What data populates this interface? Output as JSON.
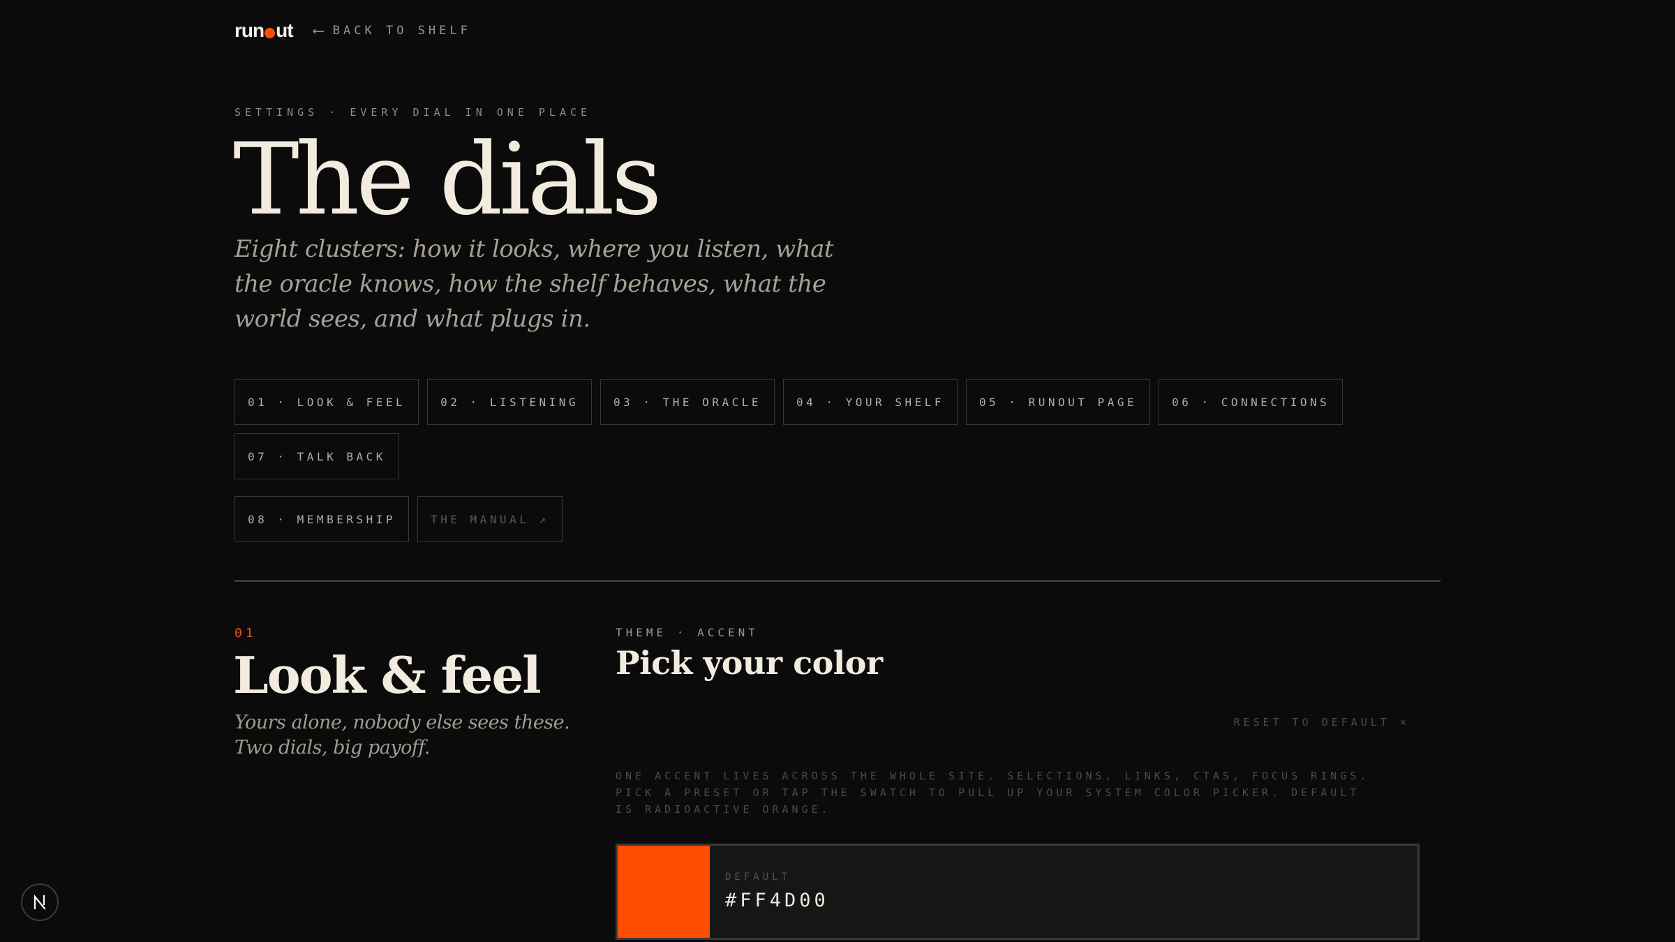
{
  "brand": {
    "logo_text_1": "run",
    "logo_text_2": "ut",
    "accent_color": "#ff4d00"
  },
  "nav": {
    "back_label": "BACK TO SHELF",
    "back_icon": "arrow-left-icon"
  },
  "header": {
    "eyebrow": "SETTINGS · EVERY DIAL IN ONE PLACE",
    "title": "The dials",
    "subtitle": "Eight clusters: how it looks, where you listen, what the oracle knows, how the shelf behaves, what the world sees, and what plugs in."
  },
  "sections_nav": [
    {
      "label": "01 · LOOK & FEEL"
    },
    {
      "label": "02 · LISTENING"
    },
    {
      "label": "03 · THE ORACLE"
    },
    {
      "label": "04 · YOUR SHELF"
    },
    {
      "label": "05 · RUNOUT PAGE"
    },
    {
      "label": "06 · CONNECTIONS"
    },
    {
      "label": "07 · TALK BACK"
    },
    {
      "label": "08 · MEMBERSHIP"
    },
    {
      "label": "THE MANUAL ↗"
    }
  ],
  "section": {
    "number": "01",
    "title": "Look & feel",
    "description": "Yours alone, nobody else sees these. Two dials, big payoff."
  },
  "setting": {
    "eyebrow": "THEME · ACCENT",
    "title": "Pick your color",
    "reset_label": "RESET TO DEFAULT ×",
    "help": "ONE ACCENT LIVES ACROSS THE WHOLE SITE. SELECTIONS, LINKS, CTAS, FOCUS RINGS. PICK A PRESET OR TAP THE SWATCH TO PULL UP YOUR SYSTEM COLOR PICKER. DEFAULT IS RADIOACTIVE ORANGE.",
    "swatch": {
      "label": "DEFAULT",
      "hex": "#FF4D00",
      "color": "#ff4d00"
    }
  },
  "devtools": {
    "badge_icon": "next-logo-icon"
  }
}
